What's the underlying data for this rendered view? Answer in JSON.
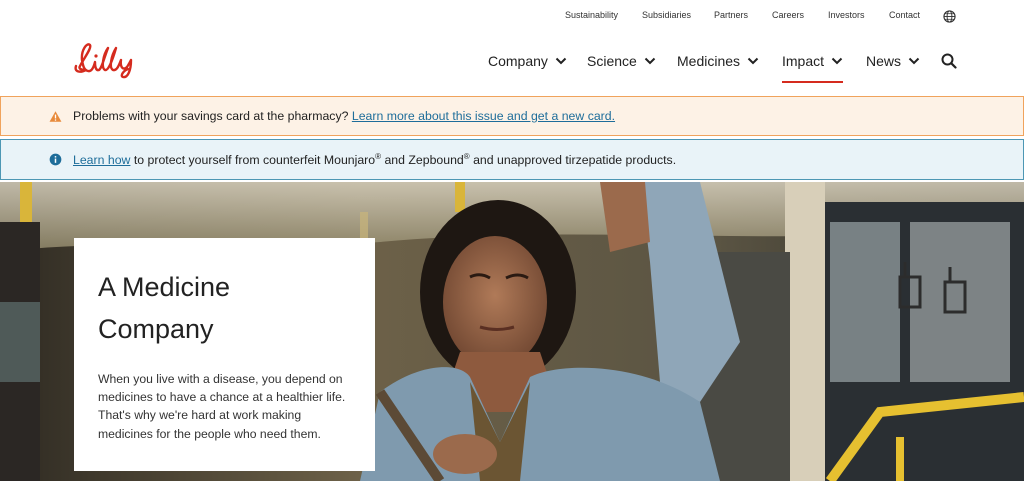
{
  "utility_nav": {
    "items": [
      "Sustainability",
      "Subsidiaries",
      "Partners",
      "Careers",
      "Investors",
      "Contact"
    ],
    "globe_icon": "globe-icon"
  },
  "brand": {
    "logo_text": "Lilly",
    "color": "#d52b1e"
  },
  "main_nav": {
    "items": [
      {
        "label": "Company",
        "active": false
      },
      {
        "label": "Science",
        "active": false
      },
      {
        "label": "Medicines",
        "active": false
      },
      {
        "label": "Impact",
        "active": true
      },
      {
        "label": "News",
        "active": false
      }
    ],
    "search_icon": "search-icon"
  },
  "alerts": {
    "warning": {
      "icon": "warning-icon",
      "text": "Problems with your savings card at the pharmacy?",
      "link": "Learn more about this issue and get a new card."
    },
    "info": {
      "icon": "info-icon",
      "link": "Learn how",
      "text_1": " to protect yourself from counterfeit Mounjaro",
      "reg_1": "®",
      "text_2": " and Zepbound",
      "reg_2": "®",
      "text_3": " and unapproved tirzepatide products."
    }
  },
  "hero": {
    "title": "A Medicine Company",
    "body": "When you live with a disease, you depend on medicines to have a chance at a healthier life. That's why we're hard at work making medicines for the people who need them."
  },
  "colors": {
    "warning_bg": "#fdf2e6",
    "warning_border": "#f0a35c",
    "info_bg": "#e9f3f8",
    "info_border": "#4d97b4",
    "link": "#1e6d9a",
    "accent": "#d52b1e"
  }
}
